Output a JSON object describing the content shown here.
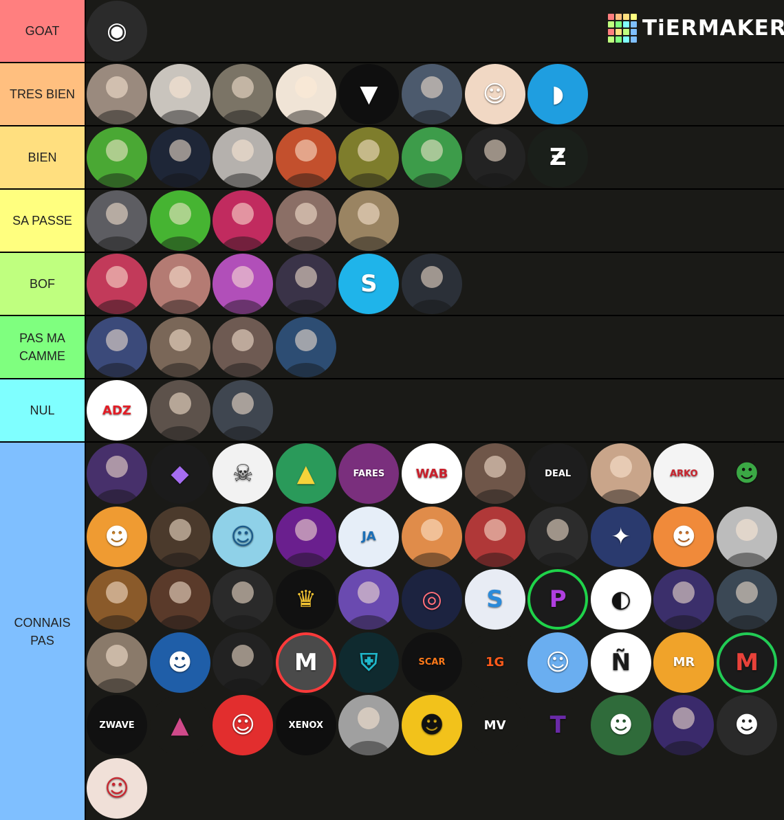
{
  "brand": {
    "logo_text": "TiERMAKER",
    "grid_colors": [
      "#ff7f7f",
      "#ffbf7f",
      "#ffdf7f",
      "#ffff7f",
      "#bfff7f",
      "#7fff7f",
      "#7fffff",
      "#7fbfff",
      "#ff7f7f",
      "#ffdf7f",
      "#bfff7f",
      "#7fbfff",
      "#bfff7f",
      "#7fff7f",
      "#7fffff",
      "#7fbfff"
    ]
  },
  "tiers": [
    {
      "label": "GOAT",
      "color": "#ff7f7f",
      "count": 1,
      "avatars": [
        {
          "icon": "masked-figure-icon",
          "bg": "#2b2b2b",
          "glyph": "◉"
        }
      ]
    },
    {
      "label": "TRES BIEN",
      "color": "#ffbf7f",
      "count": 8,
      "avatars": [
        {
          "icon": "person-photo-icon",
          "bg": "#9a8a7e"
        },
        {
          "icon": "person-cap-photo-icon",
          "bg": "#c9c4bd"
        },
        {
          "icon": "group-photo-icon",
          "bg": "#7b7466"
        },
        {
          "icon": "cartoon-character-icon",
          "bg": "#f0e4d6"
        },
        {
          "icon": "wolf-logo-icon",
          "bg": "#0f0f0f",
          "glyph": "▼"
        },
        {
          "icon": "person-photo-icon",
          "bg": "#4c5a6d"
        },
        {
          "icon": "drawn-face-icon",
          "bg": "#f1d8c4",
          "glyph": "☺"
        },
        {
          "icon": "banana-icon",
          "bg": "#1f9ee0",
          "glyph": "◗"
        }
      ]
    },
    {
      "label": "BIEN",
      "color": "#ffdf7f",
      "count": 8,
      "avatars": [
        {
          "icon": "person-hat-photo-icon",
          "bg": "#4aa834"
        },
        {
          "icon": "person-photo-icon",
          "bg": "#1e2637"
        },
        {
          "icon": "person-photo-icon",
          "bg": "#b5b1ad"
        },
        {
          "icon": "person-cap-photo-icon",
          "bg": "#c3502d"
        },
        {
          "icon": "person-photo-icon",
          "bg": "#7e7d2c"
        },
        {
          "icon": "person-headset-photo-icon",
          "bg": "#3d9c4a"
        },
        {
          "icon": "person-photo-icon",
          "bg": "#232323"
        },
        {
          "icon": "zt-logo-icon",
          "bg": "#1a1f1a",
          "glyph": "Ƶ"
        }
      ]
    },
    {
      "label": "SA PASSE",
      "color": "#ffff7f",
      "count": 5,
      "avatars": [
        {
          "icon": "person-photo-icon",
          "bg": "#5d5d62"
        },
        {
          "icon": "person-cap-photo-icon",
          "bg": "#46b432"
        },
        {
          "icon": "person-headset-photo-icon",
          "bg": "#c12b5f"
        },
        {
          "icon": "person-photo-icon",
          "bg": "#8b6f66"
        },
        {
          "icon": "teddy-bear-photo-icon",
          "bg": "#9a8462"
        }
      ]
    },
    {
      "label": "BOF",
      "color": "#bfff7f",
      "count": 6,
      "avatars": [
        {
          "icon": "person-mic-photo-icon",
          "bg": "#c23a5a"
        },
        {
          "icon": "person-photo-icon",
          "bg": "#b47b73"
        },
        {
          "icon": "person-cap-photo-icon",
          "bg": "#b14fb9"
        },
        {
          "icon": "person-cap-photo-icon",
          "bg": "#3a3348"
        },
        {
          "icon": "s-logo-icon",
          "bg": "#1fb4ea",
          "glyph": "S"
        },
        {
          "icon": "person-photo-icon",
          "bg": "#2b3038"
        }
      ]
    },
    {
      "label": "PAS MA\nCAMME",
      "color": "#7fff7f",
      "count": 4,
      "avatars": [
        {
          "icon": "person-headset-photo-icon",
          "bg": "#3b4a7a"
        },
        {
          "icon": "person-glasses-photo-icon",
          "bg": "#7a6758"
        },
        {
          "icon": "person-photo-icon",
          "bg": "#6e5a52"
        },
        {
          "icon": "person-headset-photo-icon",
          "bg": "#2d4d73"
        }
      ]
    },
    {
      "label": "NUL",
      "color": "#7fffff",
      "count": 3,
      "avatars": [
        {
          "icon": "adz-logo-icon",
          "bg": "#ffffff",
          "glyph": "ADZ",
          "fg": "#e31c25"
        },
        {
          "icon": "person-headset-photo-icon",
          "bg": "#5d524b"
        },
        {
          "icon": "person-photo-icon",
          "bg": "#3f4650"
        }
      ]
    },
    {
      "label": "CONNAIS\nPAS",
      "color": "#7fbfff",
      "count": 56,
      "avatars": [
        {
          "icon": "person-photo-icon",
          "bg": "#47306b"
        },
        {
          "icon": "crow-crystal-logo-icon",
          "bg": "#1b1b1b",
          "glyph": "◆",
          "fg": "#a66df2"
        },
        {
          "icon": "sugar-skull-icon",
          "bg": "#f2f2f2",
          "glyph": "☠",
          "fg": "#333"
        },
        {
          "icon": "banana-chair-logo-icon",
          "bg": "#2a9a5a",
          "glyph": "▲",
          "fg": "#f5d33a"
        },
        {
          "icon": "fares-logo-icon",
          "bg": "#7a2f7d",
          "glyph": "FARES"
        },
        {
          "icon": "wab-tv-logo-icon",
          "bg": "#ffffff",
          "glyph": "WAB",
          "fg": "#c91f2b"
        },
        {
          "icon": "person-photo-icon",
          "bg": "#6f5649"
        },
        {
          "icon": "deal-logo-icon",
          "bg": "#1d1d1d",
          "glyph": "DEAL"
        },
        {
          "icon": "person-photo-icon",
          "bg": "#c9a58a"
        },
        {
          "icon": "arko-tv-logo-icon",
          "bg": "#f4f4f4",
          "glyph": "ARKO",
          "fg": "#c9242e"
        },
        {
          "icon": "cartoon-character-icon",
          "bg": "#1a1a17",
          "glyph": "☻",
          "fg": "#3ba845"
        },
        {
          "icon": "tigger-icon",
          "bg": "#ef9b32",
          "glyph": "☻"
        },
        {
          "icon": "group-photo-icon",
          "bg": "#4b3a2c"
        },
        {
          "icon": "cartoon-person-icon",
          "bg": "#8fd1e8",
          "glyph": "☺",
          "fg": "#1b5a8a"
        },
        {
          "icon": "person-photo-icon",
          "bg": "#6a1f8e"
        },
        {
          "icon": "ja-logo-icon",
          "bg": "#e6eef8",
          "glyph": "JA",
          "fg": "#1a6fb8"
        },
        {
          "icon": "child-photo-icon",
          "bg": "#e08c4a"
        },
        {
          "icon": "person-photo-icon",
          "bg": "#b03838"
        },
        {
          "icon": "person-phone-photo-icon",
          "bg": "#2c2c2c"
        },
        {
          "icon": "space-logo-icon",
          "bg": "#2a3a6e",
          "glyph": "✦"
        },
        {
          "icon": "bearded-man-cartoon-icon",
          "bg": "#f08a3a",
          "glyph": "☻"
        },
        {
          "icon": "person-photo-icon",
          "bg": "#bcbcbc"
        },
        {
          "icon": "leopard-coat-photo-icon",
          "bg": "#8a5a2a"
        },
        {
          "icon": "person-photo-icon",
          "bg": "#5a3a2a"
        },
        {
          "icon": "person-photo-icon",
          "bg": "#2a2a2a"
        },
        {
          "icon": "lion-logo-icon",
          "bg": "#111111",
          "glyph": "♛",
          "fg": "#f1c232"
        },
        {
          "icon": "person-hat-photo-icon",
          "bg": "#6a4ab0"
        },
        {
          "icon": "loly-pokicake-logo-icon",
          "bg": "#1c2340",
          "glyph": "◎",
          "fg": "#ff6f7a"
        },
        {
          "icon": "s-logo-icon",
          "bg": "#e8ecf4",
          "glyph": "S",
          "fg": "#2b8ad9"
        },
        {
          "icon": "rp-logo-icon",
          "bg": "#1b1b1b",
          "glyph": "P",
          "fg": "#b03fe0",
          "ring": "#1fd34a"
        },
        {
          "icon": "half-face-icon",
          "bg": "#ffffff",
          "glyph": "◐",
          "fg": "#111"
        },
        {
          "icon": "person-photo-icon",
          "bg": "#3b2f6b"
        },
        {
          "icon": "person-mask-photo-icon",
          "bg": "#3b4855"
        },
        {
          "icon": "person-cap-photo-icon",
          "bg": "#8a7a6a"
        },
        {
          "icon": "bearded-man-cartoon-icon",
          "bg": "#1f5ea8",
          "glyph": "☻"
        },
        {
          "icon": "dj-photo-icon",
          "bg": "#222222"
        },
        {
          "icon": "m-logo-icon",
          "bg": "#4a4a4a",
          "glyph": "M",
          "ring": "#ff3a3a"
        },
        {
          "icon": "spartan-helmet-logo-icon",
          "bg": "#0f2a2f",
          "glyph": "⛨",
          "fg": "#1fb6c9"
        },
        {
          "icon": "scar-lion-logo-icon",
          "bg": "#111111",
          "glyph": "SCAR",
          "fg": "#ff7a1a"
        },
        {
          "icon": "1g-logo-icon",
          "bg": "#1a1a17",
          "glyph": "1G",
          "fg": "#ff5a1a"
        },
        {
          "icon": "cartoon-person-icon",
          "bg": "#6aaef0",
          "glyph": "☺"
        },
        {
          "icon": "n-logo-icon",
          "bg": "#ffffff",
          "glyph": "Ñ",
          "fg": "#1b1b1b"
        },
        {
          "icon": "mr-logo-icon",
          "bg": "#f0a32a",
          "glyph": "MR"
        },
        {
          "icon": "m-logo-icon",
          "bg": "#1b1b1b",
          "glyph": "M",
          "fg": "#e8423a",
          "ring": "#22cc55"
        },
        {
          "icon": "zwave-gaming-logo-icon",
          "bg": "#111111",
          "glyph": "ZWAVE"
        },
        {
          "icon": "triangle-logo-icon",
          "bg": "#1a1a17",
          "glyph": "▲",
          "fg": "#d04a8a"
        },
        {
          "icon": "cartoon-person-icon",
          "bg": "#e22e2e",
          "glyph": "☺"
        },
        {
          "icon": "xenoxgaming-logo-icon",
          "bg": "#0f0f0f",
          "glyph": "XENOX"
        },
        {
          "icon": "person-photo-icon",
          "bg": "#a0a0a0"
        },
        {
          "icon": "cartoon-person-icon",
          "bg": "#f2c21b",
          "glyph": "☻",
          "fg": "#111"
        },
        {
          "icon": "mv-logo-icon",
          "bg": "#1a1a17",
          "glyph": "MV"
        },
        {
          "icon": "t-logo-icon",
          "bg": "#1a1a17",
          "glyph": "T",
          "fg": "#6a2aa8"
        },
        {
          "icon": "bearded-man-cartoon-icon",
          "bg": "#2f6b3a",
          "glyph": "☻"
        },
        {
          "icon": "person-photo-icon",
          "bg": "#3a2a6b"
        },
        {
          "icon": "cartoon-person-icon",
          "bg": "#2a2a2a",
          "glyph": "☻"
        },
        {
          "icon": "redhead-cartoon-icon",
          "bg": "#f0e0d8",
          "glyph": "☺",
          "fg": "#c9242e"
        }
      ]
    }
  ]
}
